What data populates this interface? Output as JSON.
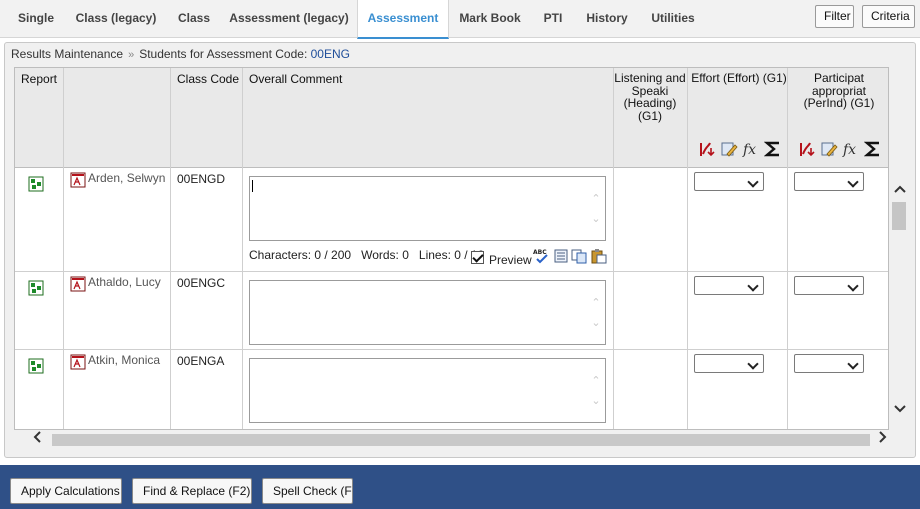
{
  "tabs": [
    {
      "label": "Single",
      "active": false
    },
    {
      "label": "Class (legacy)",
      "active": false
    },
    {
      "label": "Class",
      "active": false
    },
    {
      "label": "Assessment (legacy)",
      "active": false
    },
    {
      "label": "Assessment",
      "active": true
    },
    {
      "label": "Mark Book",
      "active": false
    },
    {
      "label": "PTI",
      "active": false
    },
    {
      "label": "History",
      "active": false
    },
    {
      "label": "Utilities",
      "active": false
    }
  ],
  "top_buttons": {
    "filter": "Filter",
    "criteria": "Criteria"
  },
  "breadcrumb": {
    "root": "Results Maintenance",
    "separator": "»",
    "current_prefix": "Students for Assessment Code:",
    "assessment_code": "00ENG"
  },
  "columns": {
    "report": "Report",
    "class_code": "Class Code",
    "overall_comment": "Overall Comment",
    "listening": "Listening and Speaki (Heading) (G1)",
    "effort": "Effort  (Effort) (G1)",
    "participation": "Participat appropriat (PerInd) (G1)"
  },
  "students": [
    {
      "name": "Arden, Selwyn",
      "class_code": "00ENGD",
      "comment": "",
      "focused": true,
      "stats": {
        "characters": "Characters: 0 / 200",
        "words": "Words: 0",
        "lines": "Lines: 0 / 10"
      },
      "preview_label": "Preview",
      "preview_checked": true,
      "effort": "",
      "participation": ""
    },
    {
      "name": "Athaldo, Lucy",
      "class_code": "00ENGC",
      "comment": "",
      "focused": false,
      "effort": "",
      "participation": ""
    },
    {
      "name": "Atkin, Monica",
      "class_code": "00ENGA",
      "comment": "",
      "focused": false,
      "effort": "",
      "participation": ""
    }
  ],
  "footer_buttons": {
    "apply": "Apply Calculations",
    "find_replace": "Find & Replace (F2)",
    "spell_check": "Spell Check (F"
  },
  "icons": {
    "report": "report-grid-icon",
    "student": "student-report-icon",
    "header_tools": [
      "flag-override-icon",
      "edit-values-icon",
      "fx-formula-icon",
      "sigma-sum-icon"
    ],
    "comment_tools": [
      "spell-check-icon",
      "comment-bank-icon",
      "copy-icon",
      "paste-icon"
    ]
  },
  "colors": {
    "accent": "#3a8fd1",
    "footer": "#2f5087",
    "code": "#1f4e9a"
  }
}
